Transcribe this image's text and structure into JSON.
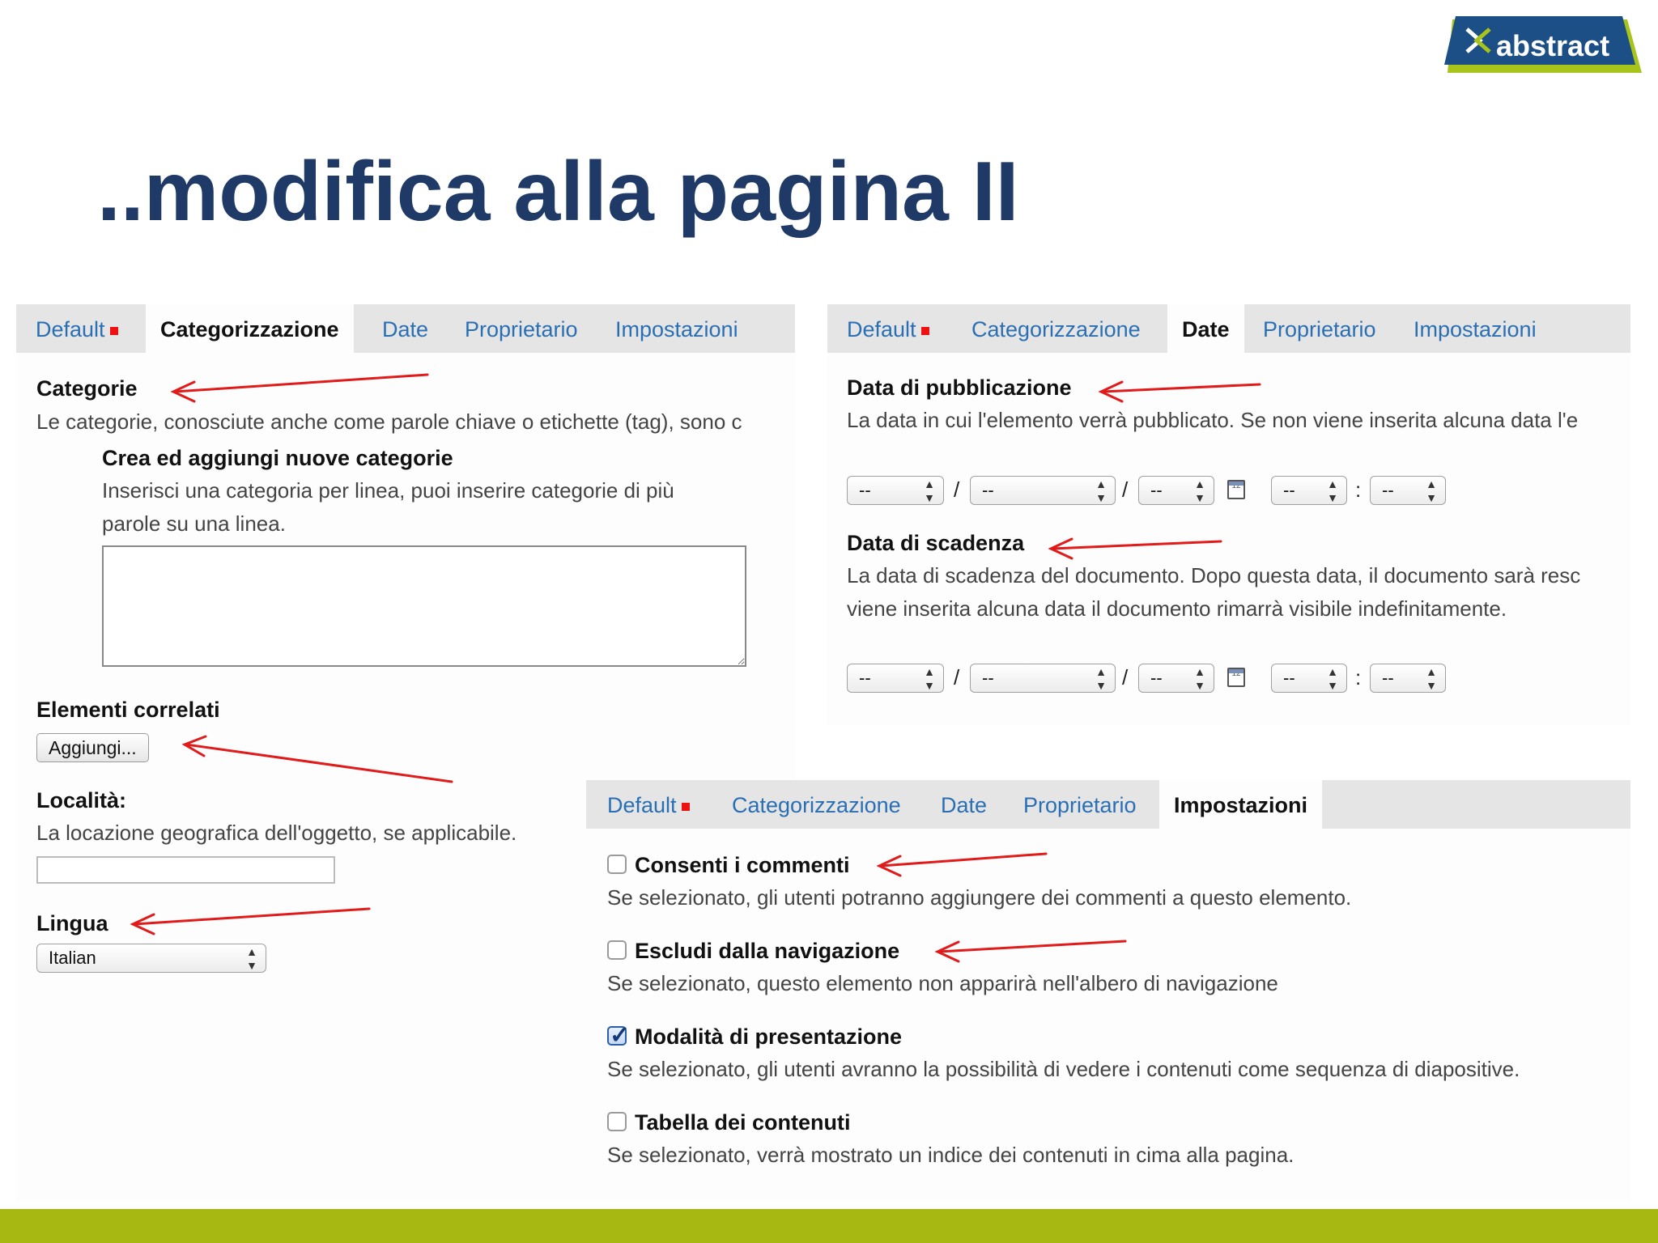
{
  "slide": {
    "title": "..modifica alla pagina II"
  },
  "logo": {
    "text": "abstract"
  },
  "colors": {
    "title": "#1f3a66",
    "link": "#2a6fb3",
    "arrow": "#e11a1a",
    "band": "#a8b813",
    "marker": "#e11111"
  },
  "panel_left": {
    "tabs": [
      {
        "label": "Default"
      },
      {
        "label": "Categorizzazione"
      },
      {
        "label": "Date"
      },
      {
        "label": "Proprietario"
      },
      {
        "label": "Impostazioni"
      }
    ],
    "active_tab": "Categorizzazione",
    "categorie": {
      "label": "Categorie",
      "help": "Le categorie, conosciute anche come parole chiave o etichette (tag), sono c"
    },
    "nuove_categorie": {
      "label": "Crea ed aggiungi nuove categorie",
      "help_line1": "Inserisci una categoria per linea, puoi inserire categorie di più",
      "help_line2": "parole su una linea.",
      "value": ""
    },
    "elementi_correlati": {
      "label": "Elementi correlati",
      "button": "Aggiungi..."
    },
    "localita": {
      "label": "Località:",
      "help": "La locazione geografica dell'oggetto, se applicabile.",
      "value": ""
    },
    "lingua": {
      "label": "Lingua",
      "selected": "Italian"
    }
  },
  "panel_right": {
    "tabs": [
      {
        "label": "Default"
      },
      {
        "label": "Categorizzazione"
      },
      {
        "label": "Date"
      },
      {
        "label": "Proprietario"
      },
      {
        "label": "Impostazioni"
      }
    ],
    "active_tab": "Date",
    "pubblicazione": {
      "label": "Data di pubblicazione",
      "help": "La data in cui l'elemento verrà pubblicato. Se non viene inserita alcuna data l'e",
      "selects": [
        "--",
        "--",
        "--",
        "--",
        "--"
      ]
    },
    "scadenza": {
      "label": "Data di scadenza",
      "help_line1": "La data di scadenza del documento. Dopo questa data, il documento sarà resc",
      "help_line2": "viene inserita alcuna data il documento rimarrà visibile indefinitamente.",
      "selects": [
        "--",
        "--",
        "--",
        "--",
        "--"
      ]
    },
    "separators": {
      "slash": "/",
      "colon": ":"
    }
  },
  "panel_settings": {
    "tabs": [
      {
        "label": "Default"
      },
      {
        "label": "Categorizzazione"
      },
      {
        "label": "Date"
      },
      {
        "label": "Proprietario"
      },
      {
        "label": "Impostazioni"
      }
    ],
    "active_tab": "Impostazioni",
    "options": [
      {
        "label": "Consenti i commenti",
        "help": "Se selezionato, gli utenti potranno aggiungere dei commenti a questo elemento.",
        "checked": false
      },
      {
        "label": "Escludi dalla navigazione",
        "help": "Se selezionato, questo elemento non apparirà nell'albero di navigazione",
        "checked": false
      },
      {
        "label": "Modalità di presentazione",
        "help": "Se selezionato, gli utenti avranno la possibilità di vedere i contenuti come sequenza di diapositive.",
        "checked": true
      },
      {
        "label": "Tabella dei contenuti",
        "help": "Se selezionato, verrà mostrato un indice dei contenuti in cima alla pagina.",
        "checked": false
      }
    ]
  }
}
